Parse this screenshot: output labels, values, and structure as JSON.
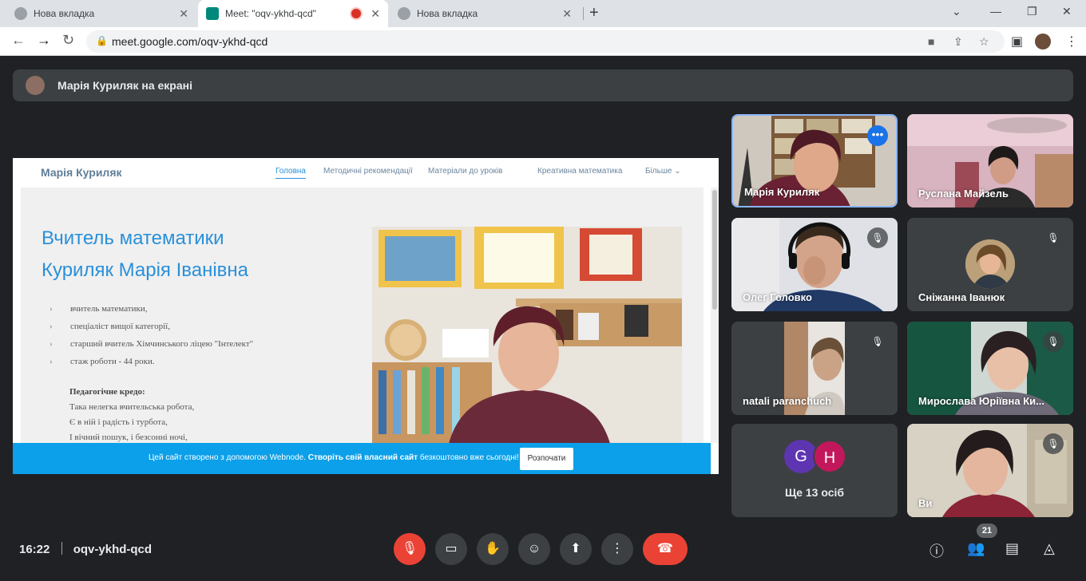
{
  "browser": {
    "tabs": [
      {
        "title": "Нова вкладка"
      },
      {
        "title": "Meet: \"oqv-ykhd-qcd\""
      },
      {
        "title": "Нова вкладка"
      }
    ],
    "url": "meet.google.com/oqv-ykhd-qcd"
  },
  "meet": {
    "presenter_banner": "Марія Куриляк на екрані",
    "time": "16:22",
    "meeting_code": "oqv-ykhd-qcd",
    "participants_count": "21"
  },
  "shared_site": {
    "site_title": "Марія Куриляк",
    "nav": [
      "Головна",
      "Методичні рекомендації",
      "Матеріали до уроків",
      "Креативна математика",
      "Більше ⌄"
    ],
    "heading_line1": "Вчитель математики",
    "heading_line2": "Куриляк Марія Іванівна",
    "bullets": [
      "вчитель математики,",
      "спеціаліст вищої категорії,",
      "старший вчитель Хімчинського ліцею \"Інтелект\"",
      "стаж роботи - 44 роки."
    ],
    "credo_title": "Педагогічне кредо:",
    "credo_lines": [
      "Така нелегка вчительська робота,",
      "Є в ній і радість і турбота,",
      "І вічний пошук, і безсонні ночі,"
    ],
    "webnode_text_prefix": "Цей сайт створено з допомогою Webnode.",
    "webnode_text_bold": "Створіть свій власний сайт",
    "webnode_text_suffix": "безкоштовно вже сьогодні!",
    "webnode_button": "Розпочати"
  },
  "tiles": [
    {
      "name": "Марія Куриляк"
    },
    {
      "name": "Руслана Майзель"
    },
    {
      "name": "Олег Головко"
    },
    {
      "name": "Сніжанна Іванюк"
    },
    {
      "name": "natali paranchuch"
    },
    {
      "name": "Мирослава Юріївна Ки..."
    },
    {
      "name": "Ще 13 осіб",
      "avatar1": "G",
      "avatar2": "H"
    },
    {
      "name": "Ви"
    }
  ],
  "colors": {
    "meet_bg": "#202124",
    "tile_bg": "#3c4043",
    "end_call": "#ea4335",
    "accent_blue": "#2a90d9",
    "webnode_blue": "#0ba0e9"
  }
}
